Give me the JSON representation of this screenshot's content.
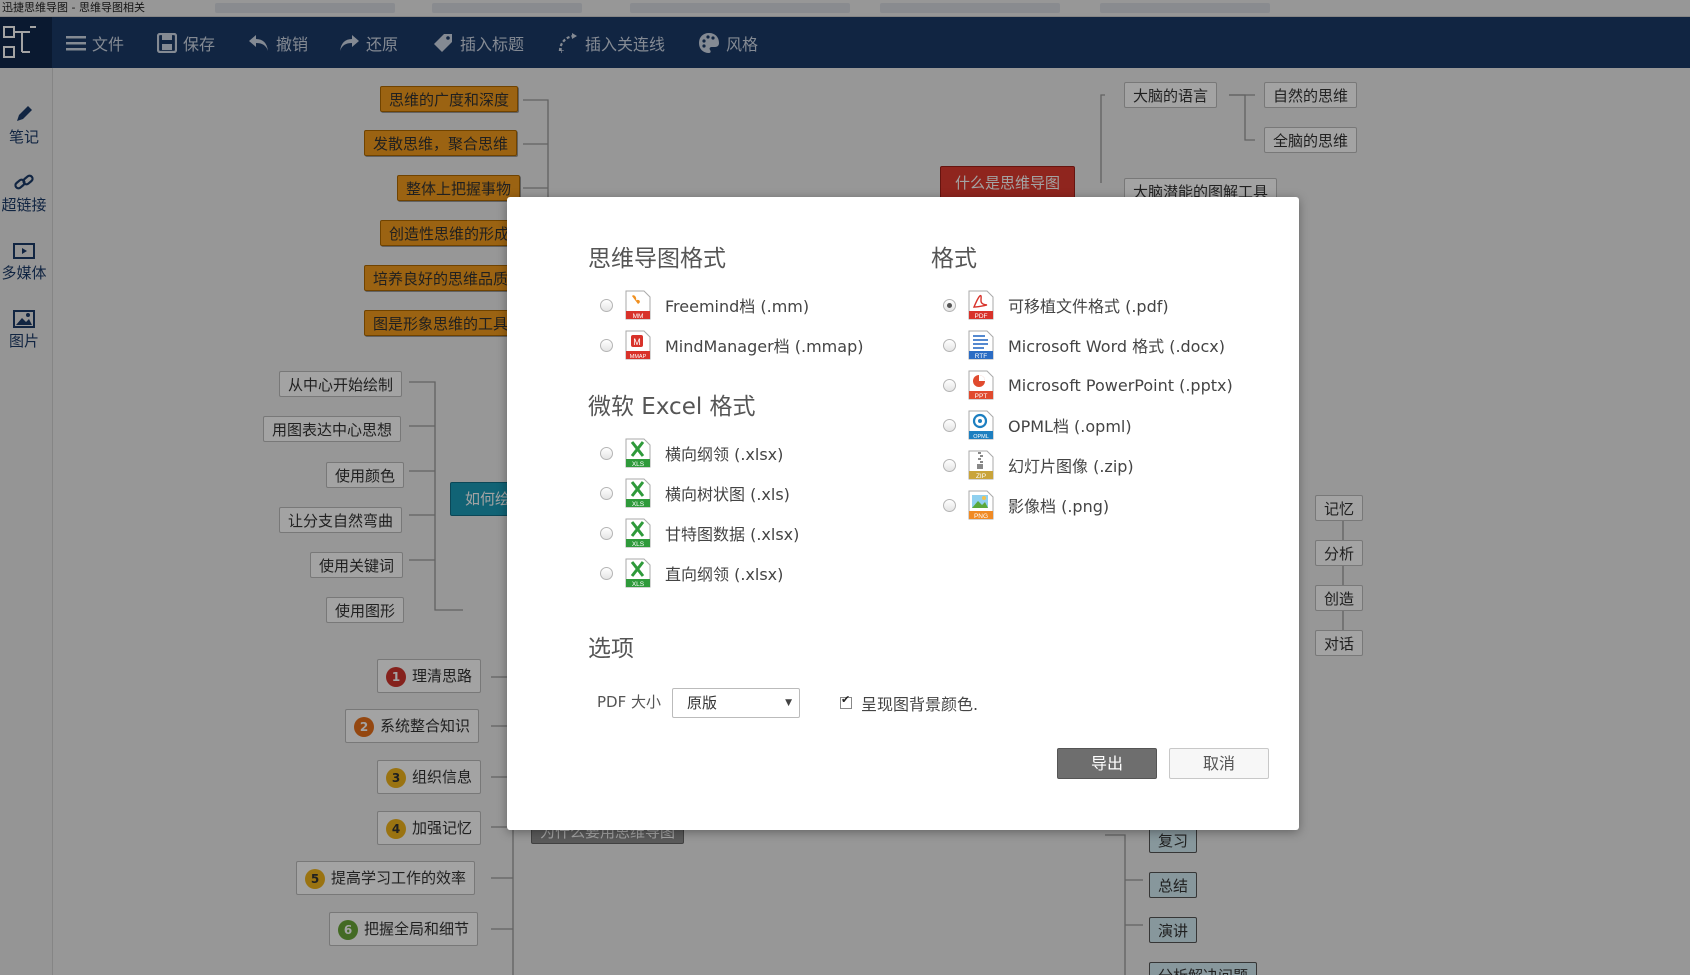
{
  "window": {
    "title": "迅捷思维导图 - 思维导图相关"
  },
  "toolbar": {
    "file": "文件",
    "save": "保存",
    "undo": "撤销",
    "redo": "还原",
    "insert_title": "插入标题",
    "insert_link": "插入关连线",
    "style": "风格"
  },
  "sidebar": {
    "note": "笔记",
    "hyperlink": "超链接",
    "multimedia": "多媒体",
    "image": "图片"
  },
  "mindmap": {
    "left_orange": [
      "思维的广度和深度",
      "发散思维，聚合思维",
      "整体上把握事物",
      "创造性思维的形成",
      "培养良好的思维品质",
      "图是形象思维的工具"
    ],
    "left_white": [
      "从中心开始绘制",
      "用图表达中心思想",
      "使用颜色",
      "让分支自然弯曲",
      "使用关键词",
      "使用图形"
    ],
    "how_to": "如何绘制思维导图",
    "numbered": [
      {
        "num": "1",
        "text": "理清思路"
      },
      {
        "num": "2",
        "text": "系统整合知识"
      },
      {
        "num": "3",
        "text": "组织信息"
      },
      {
        "num": "4",
        "text": "加强记忆"
      },
      {
        "num": "5",
        "text": "提高学习工作的效率"
      },
      {
        "num": "6",
        "text": "把握全局和细节"
      }
    ],
    "what_is": "什么是思维导图",
    "brain_language": "大脑的语言",
    "natural_thinking": "自然的思维",
    "whole_brain": "全脑的思维",
    "brain_tool": "大脑潜能的图解工具",
    "right_white": [
      "记忆",
      "分析",
      "创造",
      "对话"
    ],
    "right_cyan": [
      "复习",
      "总结",
      "演讲",
      "分析解决问题"
    ],
    "why_use": "为什么要用思维导图"
  },
  "dialog": {
    "mindmap_format_title": "思维导图格式",
    "mindmap_formats": [
      "Freemind档 (.mm)",
      "MindManager档 (.mmap)"
    ],
    "excel_title": "微软 Excel 格式",
    "excel_formats": [
      "横向纲领 (.xlsx)",
      "横向树状图 (.xls)",
      "甘特图数据 (.xlsx)",
      "直向纲领 (.xlsx)"
    ],
    "format_title": "格式",
    "formats": [
      "可移植文件格式 (.pdf)",
      "Microsoft Word 格式 (.docx)",
      "Microsoft PowerPoint (.pptx)",
      "OPML档 (.opml)",
      "幻灯片图像 (.zip)",
      "影像档 (.png)"
    ],
    "selected_format": "可移植文件格式 (.pdf)",
    "options_title": "选项",
    "pdf_size_label": "PDF 大小",
    "pdf_size_value": "原版",
    "bg_color_label": "呈现图背景颜色.",
    "bg_color_checked": true,
    "export_button": "导出",
    "cancel_button": "取消"
  },
  "icons": {
    "mm": "MM",
    "mmap": "MMAP",
    "xls": "XLS",
    "pdf": "PDF",
    "rtf": "RTF",
    "ppt": "PPT",
    "opml": "OPML",
    "zip": "ZIP",
    "png": "PNG"
  },
  "colors": {
    "toolbar": "#1c3a68",
    "orange_node": "#f29b1d",
    "red_node": "#e03b2f",
    "teal_node": "#1b9bb8"
  }
}
